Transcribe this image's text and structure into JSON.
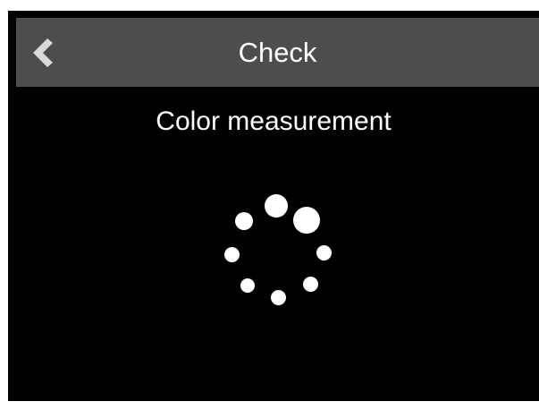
{
  "header": {
    "title": "Check",
    "back_icon": "chevron-left-icon"
  },
  "main": {
    "subtitle": "Color measurement",
    "spinner_icon": "loading-spinner-icon"
  },
  "colors": {
    "screen_background": "#000000",
    "header_background": "#4d4d4d",
    "text": "#ffffff",
    "back_icon": "#d9d9d9"
  }
}
